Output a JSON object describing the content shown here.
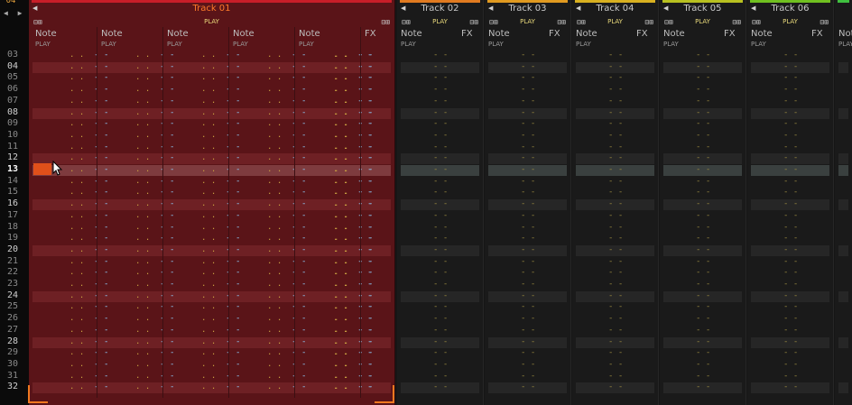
{
  "header": {
    "top_value": "04",
    "nav_arrows": "◀ ▶"
  },
  "rows": [
    {
      "n": "03",
      "major": false
    },
    {
      "n": "04",
      "major": true
    },
    {
      "n": "05",
      "major": false
    },
    {
      "n": "06",
      "major": false
    },
    {
      "n": "07",
      "major": false
    },
    {
      "n": "08",
      "major": true
    },
    {
      "n": "09",
      "major": false
    },
    {
      "n": "10",
      "major": false
    },
    {
      "n": "11",
      "major": false
    },
    {
      "n": "12",
      "major": true
    },
    {
      "n": "13",
      "major": false,
      "current": true
    },
    {
      "n": "14",
      "major": false
    },
    {
      "n": "15",
      "major": false
    },
    {
      "n": "16",
      "major": true
    },
    {
      "n": "17",
      "major": false
    },
    {
      "n": "18",
      "major": false
    },
    {
      "n": "19",
      "major": false
    },
    {
      "n": "20",
      "major": true
    },
    {
      "n": "21",
      "major": false
    },
    {
      "n": "22",
      "major": false
    },
    {
      "n": "23",
      "major": false
    },
    {
      "n": "24",
      "major": true
    },
    {
      "n": "25",
      "major": false
    },
    {
      "n": "26",
      "major": false
    },
    {
      "n": "27",
      "major": false
    },
    {
      "n": "28",
      "major": true
    },
    {
      "n": "29",
      "major": false
    },
    {
      "n": "30",
      "major": false
    },
    {
      "n": "31",
      "major": false
    },
    {
      "n": "32",
      "major": true
    }
  ],
  "tracks": [
    {
      "id": "track01",
      "name": "Track 01",
      "color": "#c81e28",
      "play": "PLAY",
      "active": true,
      "columns": [
        {
          "title": "Note",
          "sub": "PLAY"
        },
        {
          "title": "Note",
          "sub": "PLAY"
        },
        {
          "title": "Note",
          "sub": "PLAY"
        },
        {
          "title": "Note",
          "sub": "PLAY"
        },
        {
          "title": "Note",
          "sub": "PLAY"
        },
        {
          "title": "FX",
          "sub": ""
        }
      ]
    },
    {
      "id": "track02",
      "name": "Track 02",
      "color": "#e07a20",
      "play": "PLAY",
      "active": false,
      "columns": [
        {
          "title": "Note",
          "sub": "PLAY"
        },
        {
          "title": "FX",
          "sub": ""
        }
      ]
    },
    {
      "id": "track03",
      "name": "Track 03",
      "color": "#e09a20",
      "play": "PLAY",
      "active": false,
      "columns": [
        {
          "title": "Note",
          "sub": "PLAY"
        },
        {
          "title": "FX",
          "sub": ""
        }
      ]
    },
    {
      "id": "track04",
      "name": "Track 04",
      "color": "#d8b020",
      "play": "PLAY",
      "active": false,
      "columns": [
        {
          "title": "Note",
          "sub": "PLAY"
        },
        {
          "title": "FX",
          "sub": ""
        }
      ]
    },
    {
      "id": "track05",
      "name": "Track 05",
      "color": "#b8c020",
      "play": "PLAY",
      "active": false,
      "columns": [
        {
          "title": "Note",
          "sub": "PLAY"
        },
        {
          "title": "FX",
          "sub": ""
        }
      ]
    },
    {
      "id": "track06",
      "name": "Track 06",
      "color": "#70c020",
      "play": "PLAY",
      "active": false,
      "columns": [
        {
          "title": "Note",
          "sub": "PLAY"
        },
        {
          "title": "FX",
          "sub": ""
        }
      ]
    },
    {
      "id": "track07",
      "name": "",
      "color": "#40c040",
      "play": "",
      "active": false,
      "columns": [
        {
          "title": "Note",
          "sub": "PLAY"
        }
      ]
    }
  ]
}
